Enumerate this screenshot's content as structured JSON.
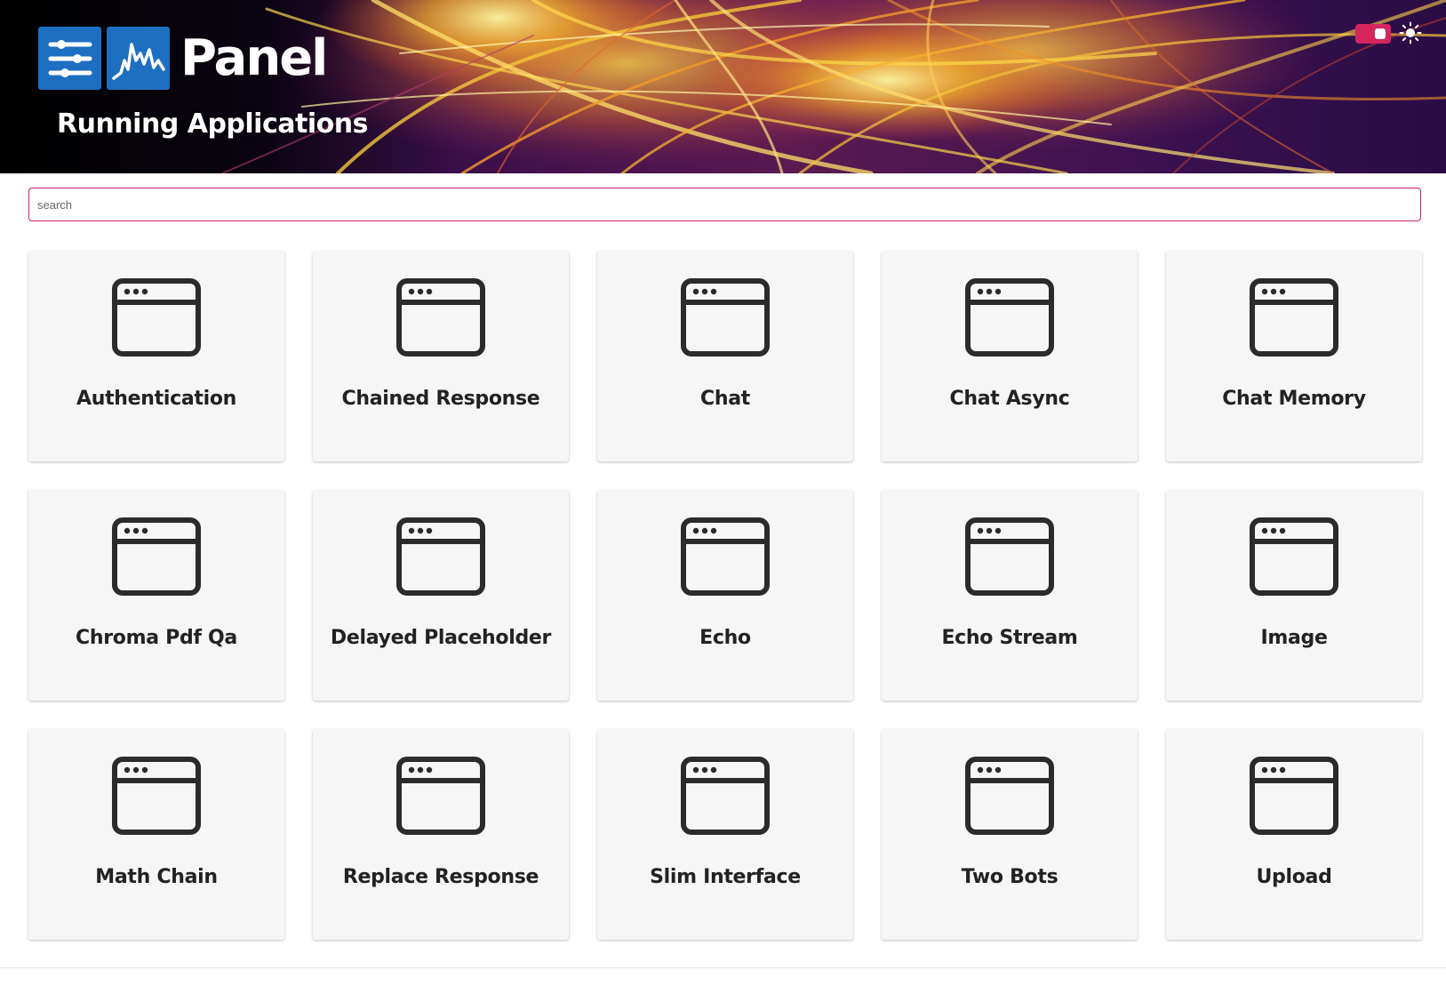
{
  "header": {
    "logo_text": "Panel",
    "title": "Running Applications"
  },
  "search": {
    "placeholder": "search",
    "value": ""
  },
  "apps": [
    {
      "label": "Authentication"
    },
    {
      "label": "Chained Response"
    },
    {
      "label": "Chat"
    },
    {
      "label": "Chat Async"
    },
    {
      "label": "Chat Memory"
    },
    {
      "label": "Chroma Pdf Qa"
    },
    {
      "label": "Delayed Placeholder"
    },
    {
      "label": "Echo"
    },
    {
      "label": "Echo Stream"
    },
    {
      "label": "Image"
    },
    {
      "label": "Math Chain"
    },
    {
      "label": "Replace Response"
    },
    {
      "label": "Slim Interface"
    },
    {
      "label": "Two Bots"
    },
    {
      "label": "Upload"
    }
  ],
  "icons": {
    "logo_sliders": "sliders-icon",
    "logo_chart": "line-chart-icon",
    "app": "browser-window-icon",
    "theme": "sun-icon"
  },
  "colors": {
    "accent": "#d6245f",
    "search_border": "#c8206a",
    "logo_blue": "#1d6fc1",
    "card_bg": "#f6f6f6"
  }
}
